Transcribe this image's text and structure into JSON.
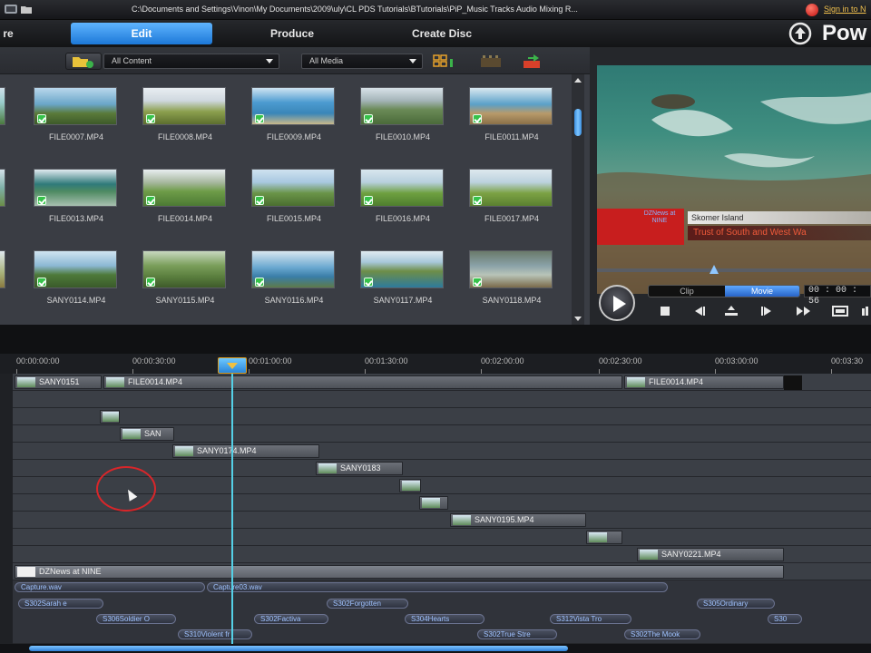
{
  "window": {
    "path": "C:\\Documents and Settings\\Vinon\\My Documents\\2009\\uly\\CL    PDS Tutorials\\BTutorials\\PiP_Music Tracks Audio Mixing R...",
    "sign_in": "Sign in to N"
  },
  "modes": {
    "capture_partial": "re",
    "edit": "Edit",
    "produce": "Produce",
    "create_disc": "Create Disc",
    "brand": "Pow"
  },
  "library": {
    "content_filter": "All Content",
    "media_filter": "All Media",
    "clips": [
      "FILE0007.MP4",
      "FILE0008.MP4",
      "FILE0009.MP4",
      "FILE0010.MP4",
      "FILE0011.MP4",
      "FILE0013.MP4",
      "FILE0014.MP4",
      "FILE0015.MP4",
      "FILE0016.MP4",
      "FILE0017.MP4",
      "SANY0114.MP4",
      "SANY0115.MP4",
      "SANY0116.MP4",
      "SANY0117.MP4",
      "SANY0118.MP4"
    ]
  },
  "preview": {
    "overlay_red": "DZNews at NINE",
    "lower_third_1": "Skomer Island",
    "lower_third_2": "Trust of South and West Wa",
    "clip_label": "Clip",
    "movie_label": "Movie",
    "timecode": "00 : 00 : 56"
  },
  "timeline": {
    "ruler": [
      "00:00:00:00",
      "00:00:30:00",
      "00:01:00:00",
      "00:01:30:00",
      "00:02:00:00",
      "00:02:30:00",
      "00:03:00:00",
      "00:03:30"
    ],
    "clips": {
      "t1a": "SANY0151",
      "t1b": "FILE0014.MP4",
      "t1c": "FILE0014.MP4",
      "t3": "SAN",
      "t4": "SANY0174.MP4",
      "t5": "SANY0183",
      "t8": "SANY0195.MP4",
      "t10": "SANY0221.MP4",
      "title": "DZNews at NINE"
    },
    "audio": {
      "a1": "Capture.wav",
      "a2": "Capture03.wav",
      "b1": "S302Sarah e",
      "b2": "S302Forgotten",
      "b3": "S305Ordinary",
      "c1": "S306Soldier O",
      "c2": "S302Factiva",
      "c3": "S304Hearts",
      "c4": "S312Vista Tro",
      "c5": "S30",
      "d1": "S310Violent fr",
      "d2": "S302True Stre",
      "d3": "S302The Mook"
    }
  }
}
